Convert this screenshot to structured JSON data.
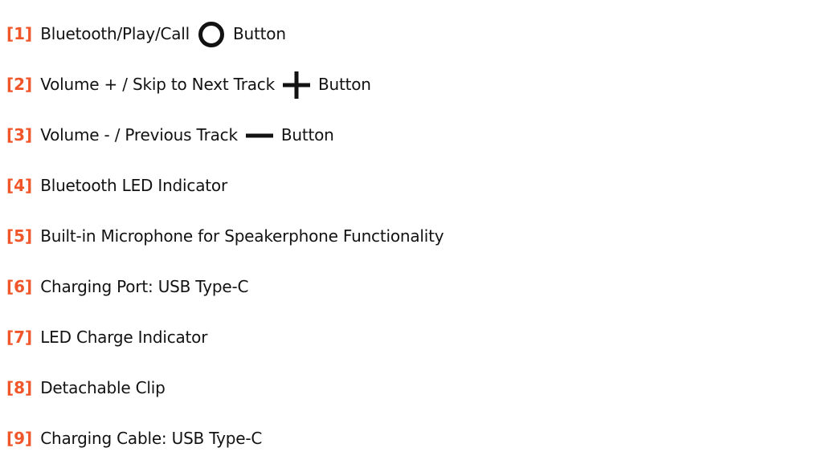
{
  "items": [
    {
      "number": "[1]",
      "text": "Bluetooth/Play/Call",
      "icon": "circle-icon",
      "suffix": "Button"
    },
    {
      "number": "[2]",
      "text": "Volume + / Skip to Next Track",
      "icon": "plus-icon",
      "suffix": "Button"
    },
    {
      "number": "[3]",
      "text": "Volume - / Previous Track",
      "icon": "minus-icon",
      "suffix": "Button"
    },
    {
      "number": "[4]",
      "text": "Bluetooth LED Indicator"
    },
    {
      "number": "[5]",
      "text": "Built-in Microphone for Speakerphone Functionality"
    },
    {
      "number": "[6]",
      "text": "Charging Port: USB Type-C"
    },
    {
      "number": "[7]",
      "text": "LED Charge Indicator"
    },
    {
      "number": "[8]",
      "text": "Detachable Clip"
    },
    {
      "number": "[9]",
      "text": "Charging Cable: USB Type-C"
    }
  ],
  "colors": {
    "accent": "#f0562a",
    "text": "#121212"
  }
}
